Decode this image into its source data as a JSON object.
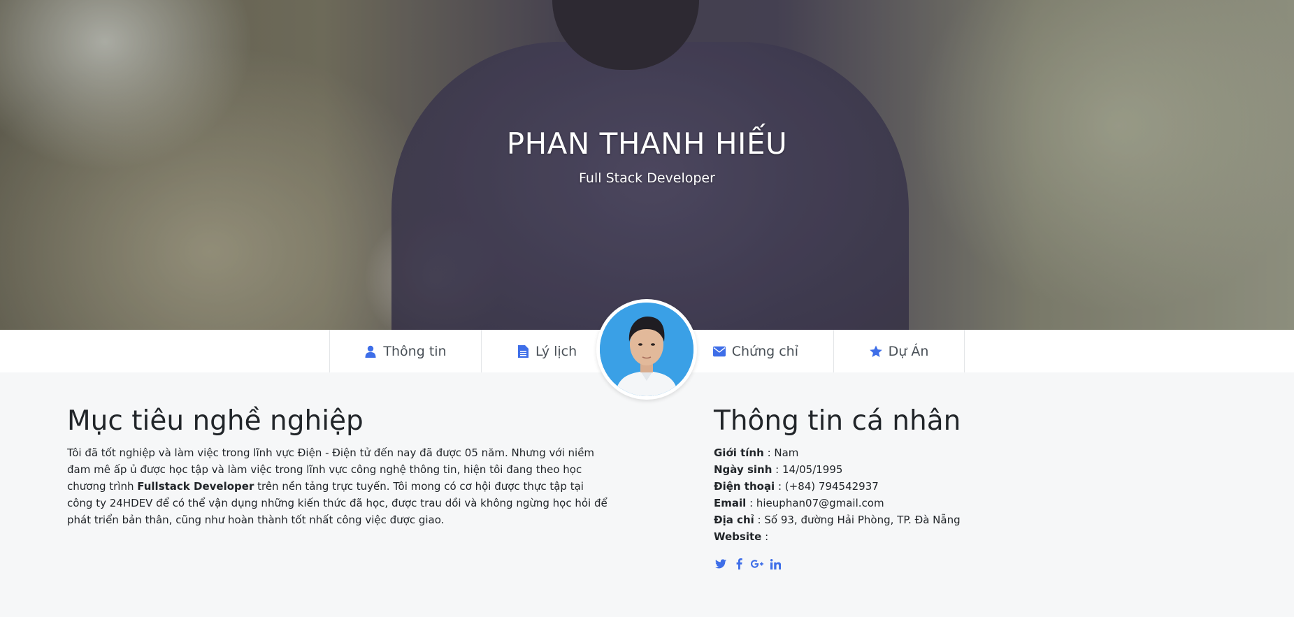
{
  "hero": {
    "name": "PHAN THANH HIẾU",
    "role": "Full Stack Developer"
  },
  "nav": {
    "tabs": [
      {
        "label": "Thông tin",
        "icon": "user-icon"
      },
      {
        "label": "Lý lịch",
        "icon": "document-icon"
      },
      {
        "label": "Chứng chỉ",
        "icon": "envelope-icon"
      },
      {
        "label": "Dự Án",
        "icon": "star-icon"
      }
    ]
  },
  "objective": {
    "title": "Mục tiêu nghề nghiệp",
    "text_before": "Tôi đã tốt nghiệp và làm việc trong lĩnh vực Điện - Điện tử đến nay đã được 05 năm. Nhưng với niềm đam mê ấp ủ được học tập và làm việc trong lĩnh vực công nghệ thông tin, hiện tôi đang theo học chương trình ",
    "text_bold": "Fullstack Developer",
    "text_after": " trên nền tảng trực tuyến. Tôi mong có cơ hội được thực tập tại công ty 24HDEV để có thể vận dụng những kiến thức đã học, được trau dồi và không ngừng học hỏi để phát triển bản thân, cũng như hoàn thành tốt nhất công việc được giao."
  },
  "personal": {
    "title": "Thông tin cá nhân",
    "rows": [
      {
        "label": "Giới tính",
        "value": " : Nam"
      },
      {
        "label": "Ngày sinh",
        "value": " : 14/05/1995"
      },
      {
        "label": "Điện thoại",
        "value": " : (+84) 794542937"
      },
      {
        "label": "Email",
        "value": " : hieuphan07@gmail.com"
      },
      {
        "label": "Địa chỉ",
        "value": " : Số 93, đường Hải Phòng, TP. Đà Nẵng"
      },
      {
        "label": "Website",
        "value": " :"
      }
    ],
    "social": [
      "twitter-icon",
      "facebook-icon",
      "google-plus-icon",
      "linkedin-icon"
    ]
  },
  "colors": {
    "accent": "#3e6ee8",
    "avatar_bg": "#3aa0e6"
  }
}
